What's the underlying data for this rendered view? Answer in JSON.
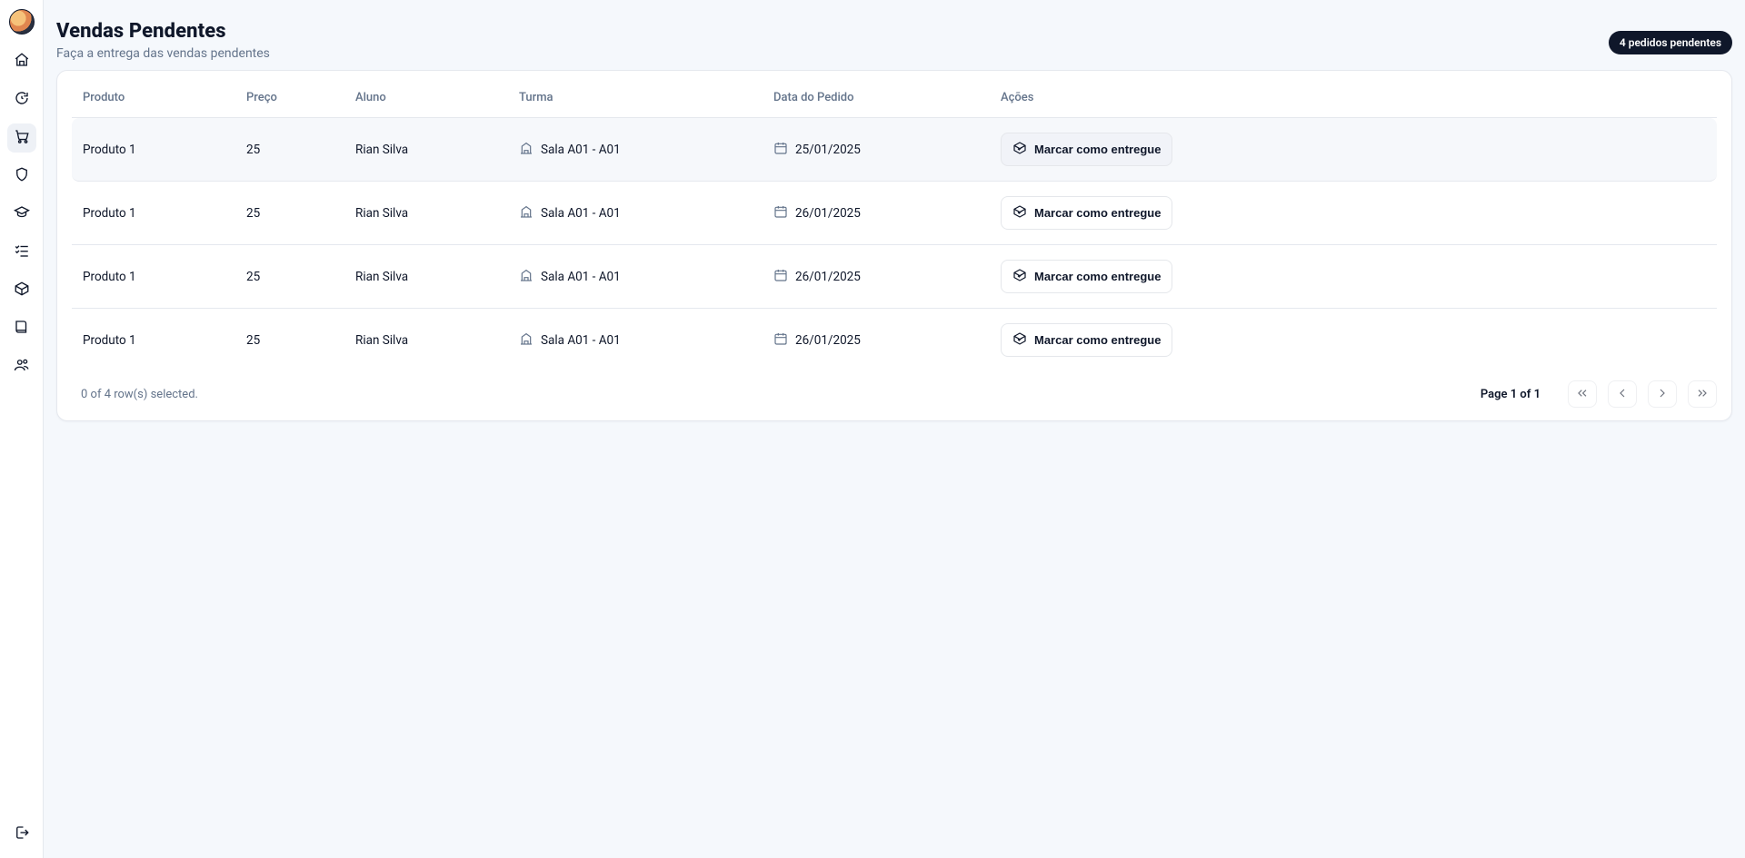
{
  "sidebar": {
    "items": [
      {
        "name": "home",
        "active": false
      },
      {
        "name": "refresh",
        "active": false
      },
      {
        "name": "cart",
        "active": true
      },
      {
        "name": "shield",
        "active": false
      },
      {
        "name": "graduation",
        "active": false
      },
      {
        "name": "checklist",
        "active": false
      },
      {
        "name": "package",
        "active": false
      },
      {
        "name": "book",
        "active": false
      },
      {
        "name": "users",
        "active": false
      }
    ],
    "logout": "logout"
  },
  "header": {
    "title": "Vendas Pendentes",
    "subtitle": "Faça a entrega das vendas pendentes",
    "badge": "4 pedidos pendentes"
  },
  "table": {
    "columns": [
      "Produto",
      "Preço",
      "Aluno",
      "Turma",
      "Data do Pedido",
      "Ações"
    ],
    "action_label": "Marcar como entregue",
    "rows": [
      {
        "produto": "Produto 1",
        "preco": "25",
        "aluno": "Rian Silva",
        "turma": "Sala A01 - A01",
        "data": "25/01/2025",
        "highlight": true
      },
      {
        "produto": "Produto 1",
        "preco": "25",
        "aluno": "Rian Silva",
        "turma": "Sala A01 - A01",
        "data": "26/01/2025",
        "highlight": false
      },
      {
        "produto": "Produto 1",
        "preco": "25",
        "aluno": "Rian Silva",
        "turma": "Sala A01 - A01",
        "data": "26/01/2025",
        "highlight": false
      },
      {
        "produto": "Produto 1",
        "preco": "25",
        "aluno": "Rian Silva",
        "turma": "Sala A01 - A01",
        "data": "26/01/2025",
        "highlight": false
      }
    ]
  },
  "footer": {
    "selected_text": "0 of 4 row(s) selected.",
    "page_text": "Page 1 of 1"
  }
}
